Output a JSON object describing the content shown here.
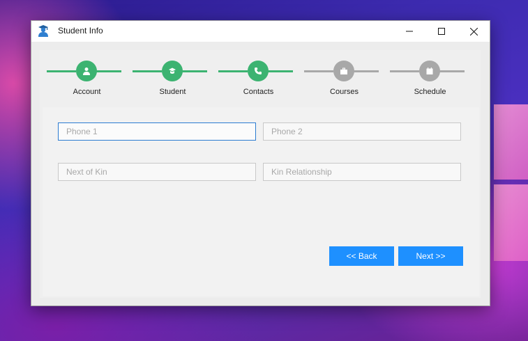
{
  "window": {
    "title": "Student Info"
  },
  "colors": {
    "complete": "#3cb371",
    "pending": "#a8a8a8",
    "accent": "#1e90ff"
  },
  "steps": [
    {
      "label": "Account",
      "icon": "user-icon",
      "status": "complete"
    },
    {
      "label": "Student",
      "icon": "graduation-cap-icon",
      "status": "complete"
    },
    {
      "label": "Contacts",
      "icon": "phone-icon",
      "status": "complete"
    },
    {
      "label": "Courses",
      "icon": "briefcase-icon",
      "status": "pending"
    },
    {
      "label": "Schedule",
      "icon": "calendar-icon",
      "status": "pending"
    }
  ],
  "form": {
    "phone1": {
      "placeholder": "Phone 1",
      "value": ""
    },
    "phone2": {
      "placeholder": "Phone 2",
      "value": ""
    },
    "next_of_kin": {
      "placeholder": "Next of Kin",
      "value": ""
    },
    "kin_relationship": {
      "placeholder": "Kin Relationship",
      "value": ""
    }
  },
  "buttons": {
    "back": "<< Back",
    "next": "Next >>"
  }
}
